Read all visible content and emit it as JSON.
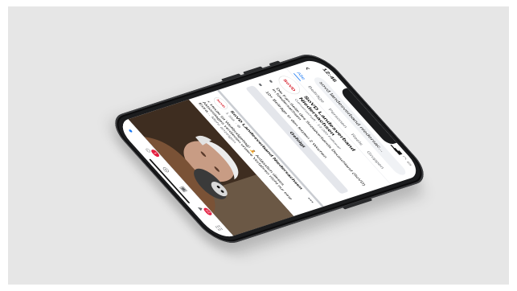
{
  "status": {
    "time": "12:46"
  },
  "search": {
    "query": "sovd landesverband niedersac..."
  },
  "tabs": [
    {
      "label": "Alle",
      "active": true
    },
    {
      "label": "Beiträge",
      "active": false
    },
    {
      "label": "Personen",
      "active": false
    },
    {
      "label": "Reels",
      "active": false
    },
    {
      "label": "Gruppen",
      "active": false
    }
  ],
  "page_result": {
    "logo_text": "SoVD",
    "name": "SoVD Landesverband Niedersachsen",
    "meta": "Gemeinschaft · 13.000 Follower",
    "info_lines": [
      {
        "icon": "■",
        "text": "Die Fan-Seite des Sozialverbands Deutschland (SoVD) in Niedersachsen"
      },
      {
        "icon": "■",
        "text": "10+ Beiträge in den letzten 2 Wochen"
      }
    ],
    "follow_label": "Gefolgt"
  },
  "post": {
    "name": "SoVD Landesverband Niedersachsen",
    "meta": "1 Std. ·",
    "text": "⚡ Heute ist Weltbudgettag! 🧘 Anlässlich dieses Aktionstages verdienen unsere Vorfahren nicht nur eine Extra...",
    "more_label": "Mehr anzeigen"
  },
  "bottom_nav": [
    {
      "name": "home",
      "icon": "●",
      "badge": "",
      "active": true
    },
    {
      "name": "friends",
      "icon": "☺",
      "badge": "1",
      "active": false
    },
    {
      "name": "groups",
      "icon": "◎",
      "badge": "",
      "active": false
    },
    {
      "name": "watch",
      "icon": "▣",
      "badge": "",
      "active": false
    },
    {
      "name": "notifications",
      "icon": "▲",
      "badge": "22",
      "active": false
    },
    {
      "name": "menu",
      "icon": "☷",
      "badge": "",
      "active": false
    }
  ],
  "colors": {
    "accent": "#1877f2",
    "brand": "#d4111e",
    "badge": "#e41e3f"
  }
}
